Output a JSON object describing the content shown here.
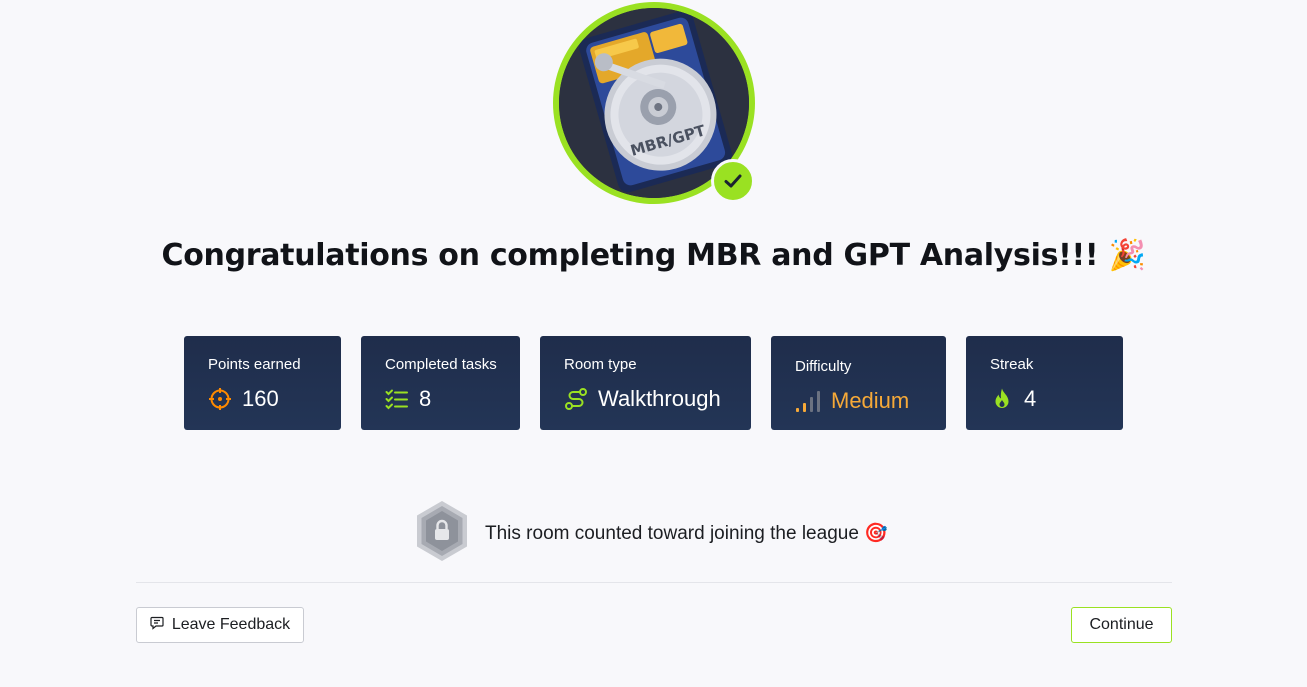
{
  "room": {
    "badge_icon": "hard-drive-icon",
    "badge_text": "MBR/GPT",
    "completed_icon": "check-icon",
    "title": "Congratulations on completing MBR and GPT Analysis!!!",
    "title_emoji": "🎉"
  },
  "stats": {
    "points": {
      "label": "Points earned",
      "value": "160",
      "icon": "crosshair-icon"
    },
    "tasks": {
      "label": "Completed tasks",
      "value": "8",
      "icon": "checklist-icon"
    },
    "room_type": {
      "label": "Room type",
      "value": "Walkthrough",
      "icon": "route-icon"
    },
    "difficulty": {
      "label": "Difficulty",
      "value": "Medium",
      "icon": "signal-bars-icon",
      "level": 0.5
    },
    "streak": {
      "label": "Streak",
      "value": "4",
      "icon": "flame-icon"
    }
  },
  "league": {
    "icon": "locked-hexagon-icon",
    "text": "This room counted toward joining the league",
    "emoji": "🎯"
  },
  "footer": {
    "feedback_label": "Leave Feedback",
    "continue_label": "Continue"
  },
  "colors": {
    "accent": "#9ae122",
    "card_bg": "#223353",
    "difficulty": "#f6a938",
    "points_icon": "#ff8a00"
  }
}
